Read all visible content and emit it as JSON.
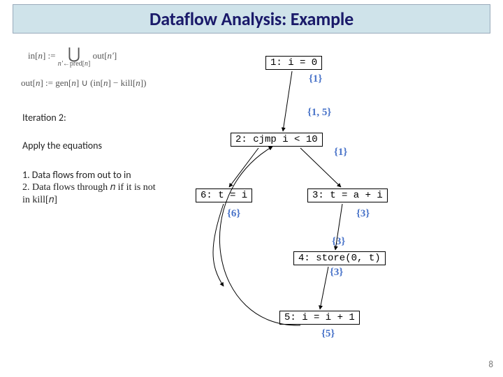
{
  "title": "Dataflow Analysis: Example",
  "equations": {
    "in": "in[n] := ⋃_{n'←pred[n]} out[n']",
    "out": "out[n] := gen[n] ∪ (in[n] − kill[n])"
  },
  "iteration_label": "Iteration 2:",
  "apply_label": "Apply the equations",
  "rules": {
    "r1": "1. Data flows from out to in",
    "r2a": "2. Data flows through 𝑛 if it is not",
    "r2b": "in kill[𝑛]"
  },
  "nodes": {
    "n1": "1: i = 0",
    "n2": "2: cjmp i < 10",
    "n3": "3: t = a + i",
    "n4": "4: store(0, t)",
    "n5": "5: i = i + 1",
    "n6": "6: t = i"
  },
  "sets": {
    "s1_out": "{1}",
    "s2_in": "{1, 5}",
    "s2_out": "{1}",
    "s3_out": "{3}",
    "s4_in": "{3}",
    "s4_out": "{3}",
    "s5_out": "{5}",
    "s6_out": "{6}"
  },
  "page_number": "8"
}
